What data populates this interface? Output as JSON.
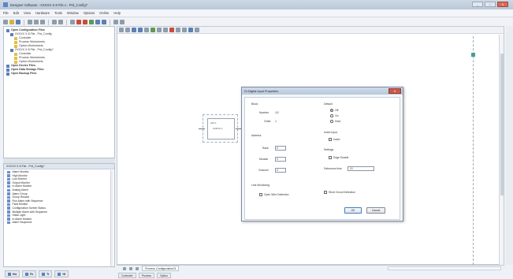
{
  "app": {
    "title": "Designer Software - XXXXX X-8 File x - Prd_Config?",
    "window_buttons": [
      "_",
      "□",
      "X"
    ]
  },
  "menu": [
    "File",
    "Edit",
    "View",
    "Hardware",
    "Tools",
    "Window",
    "Options",
    "Online",
    "Help"
  ],
  "tree": {
    "items": [
      {
        "label": "Open Configuration Files",
        "bold": true
      },
      {
        "label": "XXXXX X-8 File - Prd_Config",
        "bold": false
      },
      {
        "label": "Controller",
        "bold": false
      },
      {
        "label": "Process Worksheets",
        "bold": false
      },
      {
        "label": "Option Worksheets",
        "bold": false
      },
      {
        "label": "XXXXX X-8 File - Prd_Config?",
        "bold": false
      },
      {
        "label": "Controller",
        "bold": false
      },
      {
        "label": "Process Worksheets",
        "bold": false
      },
      {
        "label": "Option Worksheets",
        "bold": false
      },
      {
        "label": "Open Device Files",
        "bold": true
      },
      {
        "label": "Open Data Storage Files",
        "bold": true
      },
      {
        "label": "Open Backup Files",
        "bold": true
      }
    ]
  },
  "palette": {
    "header": "XXXXX X-8 File - Prd_Config?",
    "items": [
      "Alarm Monitor",
      "High Monitor",
      "Low Monitor",
      "Output Monitor",
      "In Alarm Monitor",
      "Analog Alarm",
      "Alarm Group",
      "Group Restart",
      "Run Alarm with Sequence",
      "Fault Monitor",
      "Configuration Screen Status",
      "Multiple Alarm with Sequence",
      "Stack Light",
      "In Alarm Monitor",
      "Alarm Sequence"
    ]
  },
  "bottom_tabs": [
    "Hw",
    "Fn",
    "Tr",
    "Ht"
  ],
  "block": {
    "title": "ADI-1",
    "subtitle": "1008-DI-1"
  },
  "dialog": {
    "title": "DI Digital Input Properties",
    "close": "X",
    "block_label": "Block",
    "number_label": "Number",
    "number_value": "1/2",
    "order_label": "Order",
    "order_value": "1",
    "address_label": "Address",
    "rack_label": "Rack",
    "rack_value": "0",
    "module_label": "Module",
    "module_value": "4",
    "channel_label": "Channel",
    "channel_value": "4",
    "default_label": "Default",
    "radio_off": "Off",
    "radio_on": "On",
    "radio_hold": "Hold",
    "invert_section": "Invert Input",
    "invert_label": "Invert",
    "settings_label": "Settings",
    "edge_label": "Edge Enable",
    "debounce_label": "Debounce time",
    "debounce_value": "10",
    "monitoring_label": "Line Monitoring",
    "open_wire_label": "Open Wire Detection",
    "short_circuit_label": "Short Circuit Detection",
    "ok": "OK",
    "cancel": "Cancel"
  },
  "sheet_tab": "Process Configuration01",
  "status_tabs": [
    "Controller",
    "Process",
    "Option"
  ]
}
